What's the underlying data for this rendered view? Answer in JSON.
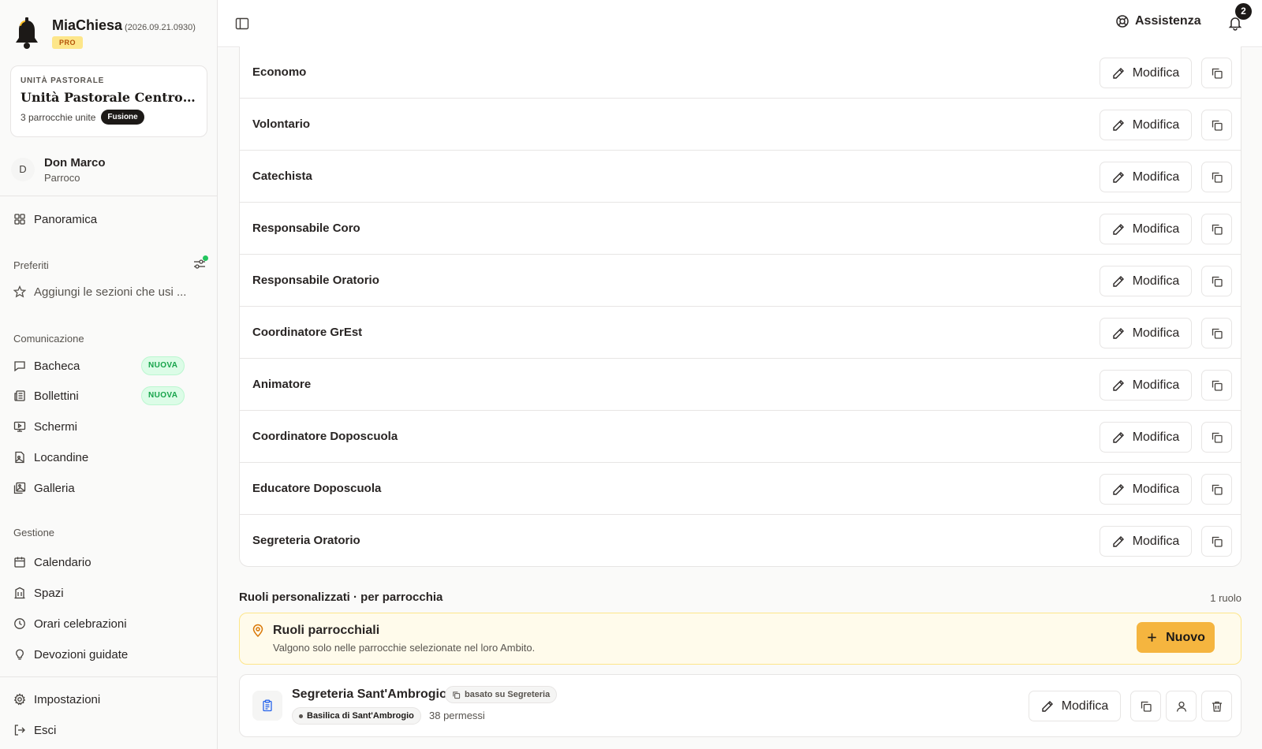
{
  "app": {
    "name": "MiaChiesa",
    "version": "(2026.09.21.0930)",
    "plan": "PRO"
  },
  "unit": {
    "label": "UNITÀ PASTORALE",
    "title": "Unità Pastorale Centro Sto...",
    "parishes": "3 parrocchie unite",
    "badge": "Fusione"
  },
  "user": {
    "initial": "D",
    "name": "Don Marco",
    "role": "Parroco"
  },
  "sidebar": {
    "overview": "Panoramica",
    "favorites_label": "Preferiti",
    "favorites_hint": "Aggiungi le sezioni che usi ...",
    "communication_label": "Comunicazione",
    "communication": [
      {
        "label": "Bacheca",
        "badge": "NUOVA",
        "icon": "message-square-icon"
      },
      {
        "label": "Bollettini",
        "badge": "NUOVA",
        "icon": "newspaper-icon"
      },
      {
        "label": "Schermi",
        "icon": "monitor-icon"
      },
      {
        "label": "Locandine",
        "icon": "file-image-icon"
      },
      {
        "label": "Galleria",
        "icon": "images-icon"
      }
    ],
    "management_label": "Gestione",
    "management": [
      {
        "label": "Calendario",
        "icon": "calendar-icon"
      },
      {
        "label": "Spazi",
        "icon": "building-icon"
      },
      {
        "label": "Orari celebrazioni",
        "icon": "clock-icon"
      },
      {
        "label": "Devozioni guidate",
        "icon": "lightbulb-icon"
      }
    ],
    "settings": "Impostazioni",
    "logout": "Esci"
  },
  "topbar": {
    "help": "Assistenza",
    "notifications": "2"
  },
  "roles": {
    "edit_label": "Modifica",
    "items": [
      "Economo",
      "Volontario",
      "Catechista",
      "Responsabile Coro",
      "Responsabile Oratorio",
      "Coordinatore GrEst",
      "Animatore",
      "Coordinatore Doposcuola",
      "Educatore Doposcuola",
      "Segreteria Oratorio"
    ]
  },
  "custom_roles": {
    "title": "Ruoli personalizzati · per parrocchia",
    "count": "1 ruolo",
    "info_title": "Ruoli parrocchiali",
    "info_subtitle": "Valgono solo nelle parrocchie selezionate nel loro Ambito.",
    "new_button": "Nuovo",
    "item": {
      "name": "Segreteria Sant'Ambrogio",
      "based_on": "basato su Segreteria",
      "parish": "Basilica di Sant'Ambrogio",
      "permissions": "38 permessi",
      "edit_label": "Modifica"
    }
  },
  "colors": {
    "accent": "#f5b53f",
    "new_badge": "#16a34a",
    "dark": "#1c1917"
  }
}
